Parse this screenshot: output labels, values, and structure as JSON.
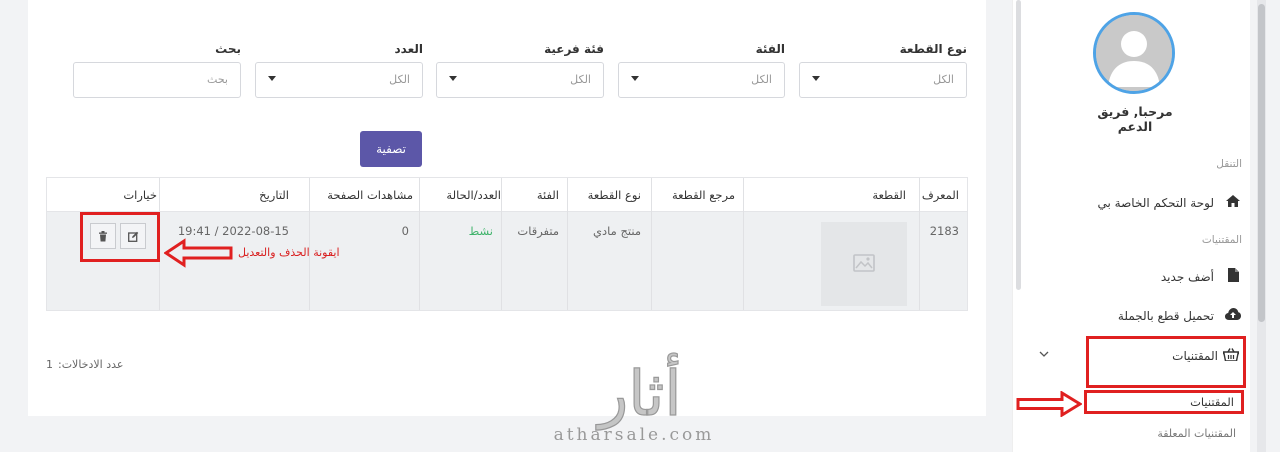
{
  "filters": [
    {
      "label": "نوع القطعة",
      "value": "الكل"
    },
    {
      "label": "الفئة",
      "value": "الكل"
    },
    {
      "label": "فئة فرعية",
      "value": "الكل"
    },
    {
      "label": "العدد",
      "value": "الكل"
    },
    {
      "label": "بحث",
      "placeholder": "بحث"
    }
  ],
  "filter_button": "تصفية",
  "table": {
    "headers": [
      "المعرف",
      "القطعة",
      "مرجع القطعة",
      "نوع القطعة",
      "الفئة",
      "العدد/الحالة",
      "مشاهدات الصفحة",
      "التاريخ",
      "خيارات"
    ],
    "row": {
      "id": "2183",
      "type": "منتج مادي",
      "category": "متفرقات",
      "status": "نشط",
      "views": "0",
      "date": "2022-08-15 / 19:41"
    }
  },
  "annotation": "ايقونة الحذف والتعديل",
  "entries": {
    "label": "عدد الادخالات:",
    "count": "1"
  },
  "sidebar": {
    "greeting": "مرحبا, فريق الدعم",
    "section_nav": "التنقل",
    "dashboard": "لوحة التحكم الخاصة بي",
    "section_products": "المقتنيات",
    "add_new": "أضف جديد",
    "bulk_upload": "تحميل قطع بالجملة",
    "products_menu": "المقتنيات",
    "products_sub": "المقتنيات",
    "pending_sub": "المقتنيات المعلقة"
  },
  "watermark": {
    "logo_text": "أثار",
    "url": "atharsale.com"
  },
  "colors": {
    "accent": "#5c57a8",
    "annotation_red": "#e02020",
    "active_green": "#3fb36b",
    "avatar_ring": "#4ea3e6"
  }
}
